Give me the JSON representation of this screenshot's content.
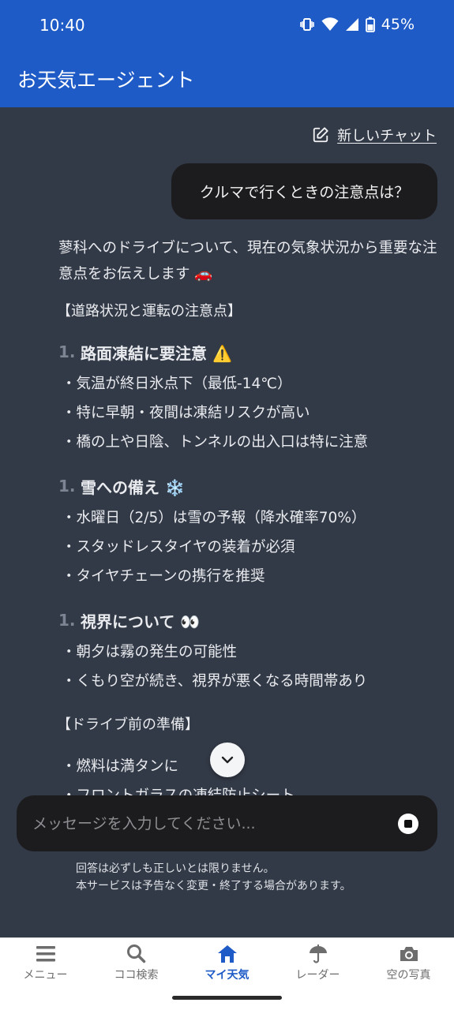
{
  "status_bar": {
    "time": "10:40",
    "battery": "45%"
  },
  "app": {
    "title": "お天気エージェント"
  },
  "chat": {
    "new_chat_label": "新しいチャット",
    "user_message": "クルマで行くときの注意点は？",
    "reply": {
      "intro": "蓼科へのドライブについて、現在の気象状況から重要な注意点をお伝えします 🚗",
      "section_title": "【道路状況と運転の注意点】",
      "blocks": [
        {
          "num": "1.",
          "title": "路面凍結に要注意 ⚠️",
          "bullets": [
            "・気温が終日氷点下（最低-14℃）",
            "・特に早朝・夜間は凍結リスクが高い",
            "・橋の上や日陰、トンネルの出入口は特に注意"
          ]
        },
        {
          "num": "1.",
          "title": "雪への備え ❄️",
          "bullets": [
            "・水曜日（2/5）は雪の予報（降水確率70%）",
            "・スタッドレスタイヤの装着が必須",
            "・タイヤチェーンの携行を推奨"
          ]
        },
        {
          "num": "1.",
          "title": "視界について 👀",
          "bullets": [
            "・朝夕は霧の発生の可能性",
            "・くもり空が続き、視界が悪くなる時間帯あり"
          ]
        }
      ],
      "section2_title": "【ドライブ前の準備】",
      "prep_bullets": [
        "・燃料は満タンに",
        "・フロントガラスの凍結防止シート"
      ]
    }
  },
  "input": {
    "placeholder": "メッセージを入力してください..."
  },
  "disclaimer": {
    "line1": "回答は必ずしも正しいとは限りません。",
    "line2": "本サービスは予告なく変更・終了する場合があります。"
  },
  "nav": {
    "items": [
      {
        "label": "メニュー",
        "icon": "menu-icon"
      },
      {
        "label": "ココ検索",
        "icon": "search-icon"
      },
      {
        "label": "マイ天気",
        "icon": "home-icon"
      },
      {
        "label": "レーダー",
        "icon": "radar-umbrella-icon"
      },
      {
        "label": "空の写真",
        "icon": "camera-icon"
      }
    ],
    "active_index": 2
  },
  "colors": {
    "accent": "#1e5bc6",
    "chat_bg": "#333a47",
    "bubble_bg": "#1c1c1e"
  }
}
